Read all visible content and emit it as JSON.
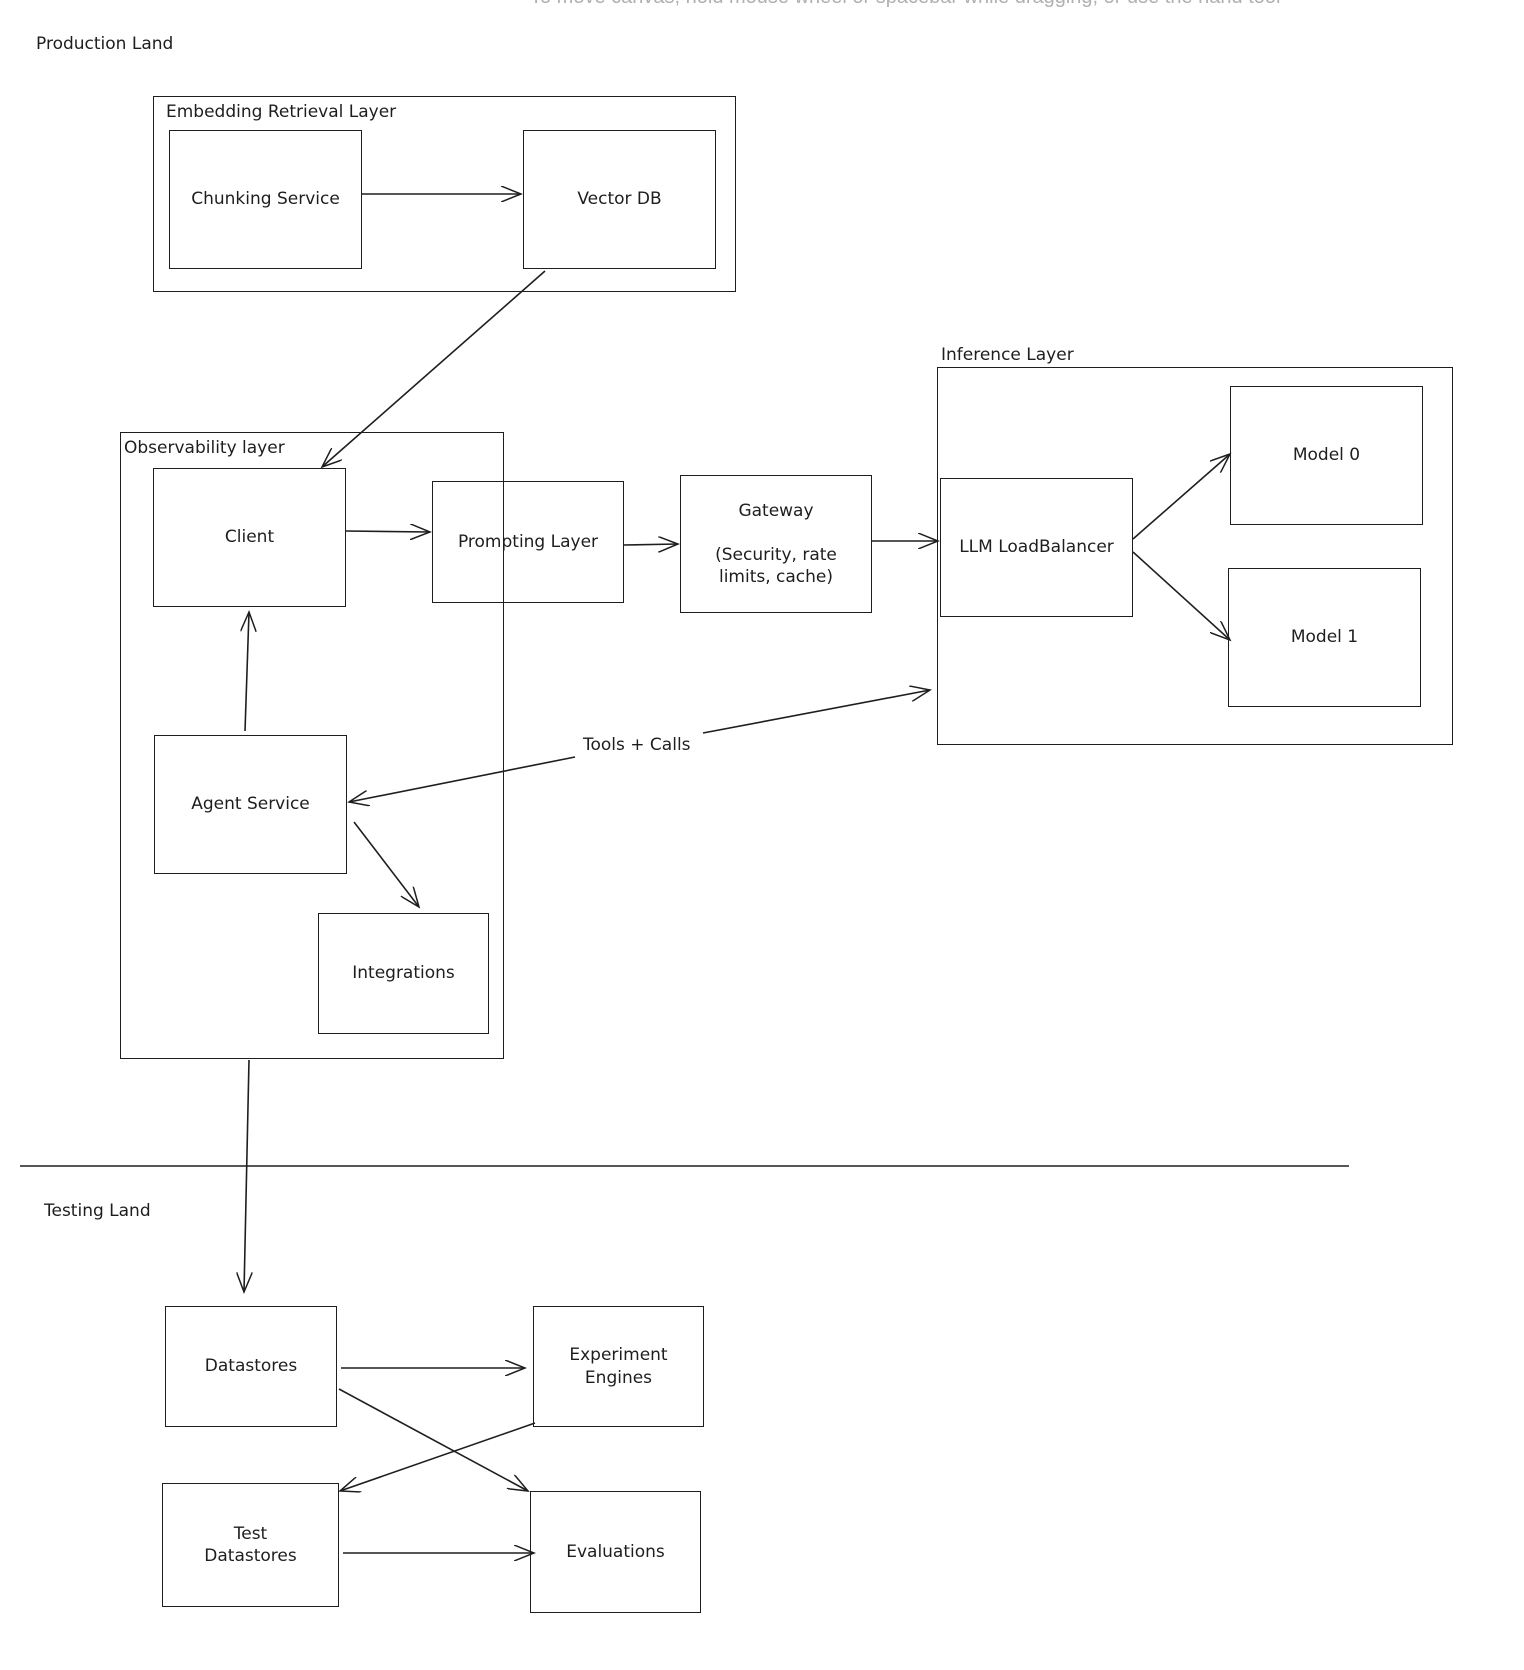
{
  "hint": "To move canvas, hold mouse wheel or spacebar while dragging, or use the hand tool",
  "sections": {
    "production": "Production Land",
    "testing": "Testing Land"
  },
  "groups": {
    "embedding": "Embedding Retrieval Layer",
    "observability": "Observability layer",
    "inference": "Inference Layer"
  },
  "nodes": {
    "chunking": "Chunking Service",
    "vectordb": "Vector DB",
    "client": "Client",
    "prompting": "Prompting Layer",
    "gateway": "Gateway\n\n(Security, rate\nlimits, cache)",
    "loadbalancer": "LLM LoadBalancer",
    "model0": "Model 0",
    "model1": "Model 1",
    "agent": "Agent Service",
    "integrations": "Integrations",
    "datastores": "Datastores",
    "experiment": "Experiment\nEngines",
    "testdatastores": "Test\nDatastores",
    "evaluations": "Evaluations"
  },
  "edges": {
    "tools_label": "Tools + Calls"
  }
}
